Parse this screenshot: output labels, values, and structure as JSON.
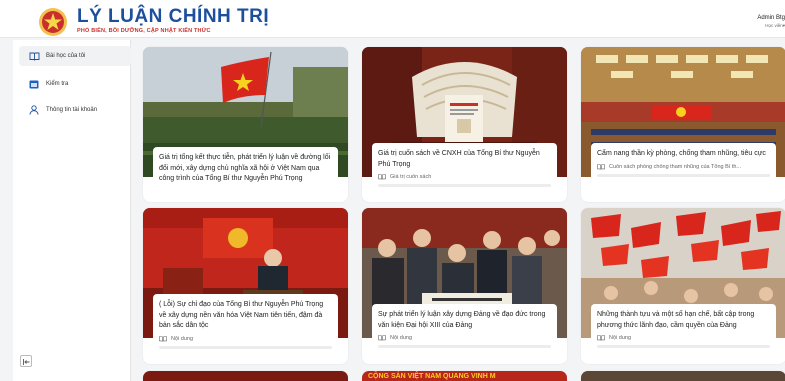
{
  "header": {
    "title": "LÝ LUẬN CHÍNH TRỊ",
    "subtitle": "PHỔ BIẾN, BỒI DƯỠNG, CẬP NHẬT KIẾN THỨC",
    "user_name": "Admin Btg",
    "user_role": "Học viên▾"
  },
  "sidebar": {
    "items": [
      {
        "label": "Bài học của tôi",
        "icon": "book-icon",
        "active": true
      },
      {
        "label": "Kiểm tra",
        "icon": "calendar-icon",
        "active": false
      },
      {
        "label": "Thông tin tài khoản",
        "icon": "user-icon",
        "active": false
      }
    ]
  },
  "cards": [
    {
      "title": "Giá trị tổng kết thực tiễn, phát triển lý luận về đường lối đổi mới, xây dựng chủ nghĩa xã hội ở Việt Nam qua công trình của Tổng Bí thư Nguyễn Phú Trọng",
      "category": "",
      "image": "military-parade-flag-photo"
    },
    {
      "title": "Giá trị cuốn sách về CNXH của Tổng Bí thư Nguyễn Phú Trọng",
      "category": "Giá trị cuốn sách",
      "image": "book-display-photo"
    },
    {
      "title": "Cẩm nang thần kỳ phòng, chống tham nhũng, tiêu cực",
      "category": "Cuốn sách phòng chống tham nhũng của Tổng Bí th...",
      "image": "conference-hall-photo"
    },
    {
      "title": "( Lỗi) Sự chỉ đạo của Tổng Bí thư Nguyễn Phú Trọng về xây dựng nền văn hóa Việt Nam tiên tiến, đậm đà bản sắc dân tộc",
      "category": "Nội dung",
      "image": "speaker-podium-photo"
    },
    {
      "title": "Sự phát triển lý luận xây dựng Đảng về đạo đức trong văn kiện Đại hội XIII của Đảng",
      "category": "Nội dung",
      "image": "crowd-calligraphy-photo"
    },
    {
      "title": "Những thành tựu và một số hạn chế, bất cập trong phương thức lãnh đạo, cầm quyền của Đảng",
      "category": "Nội dung",
      "image": "flag-crowd-photo"
    }
  ],
  "partial_banner_text": "CỘNG SẢN VIỆT NAM QUANG VINH M",
  "colors": {
    "brand_blue": "#1d4f9c",
    "brand_red": "#c9302c"
  }
}
